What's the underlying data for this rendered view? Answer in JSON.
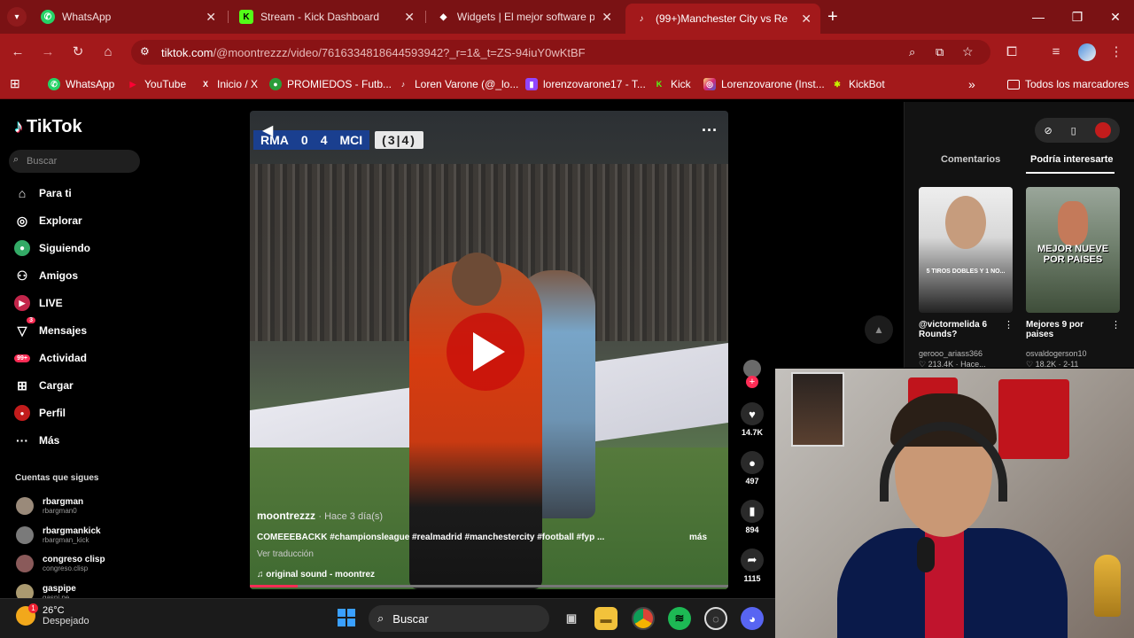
{
  "browser": {
    "tabs": [
      {
        "title": "WhatsApp",
        "icon": "whatsapp-icon",
        "color": "#25d366"
      },
      {
        "title": "Stream - Kick Dashboard",
        "icon": "kick-icon",
        "color": "#53fc18"
      },
      {
        "title": "Widgets | El mejor software par",
        "icon": "widgets-icon",
        "color": "#ffffff"
      },
      {
        "title": "(99+)Manchester City vs Re",
        "icon": "tiktok-icon",
        "color": "#ffffff"
      }
    ],
    "new_tab": "+",
    "url_main": "tiktok.com",
    "url_rest": "/@moontrezzz/video/7616334818644593942?_r=1&_t=ZS-94iuY0wKtBF",
    "bookmarks": [
      {
        "label": "WhatsApp",
        "icon": "whatsapp-icon"
      },
      {
        "label": "YouTube",
        "icon": "youtube-icon"
      },
      {
        "label": "Inicio / X",
        "icon": "x-icon"
      },
      {
        "label": "PROMIEDOS - Futb...",
        "icon": "promiedos-icon"
      },
      {
        "label": "Loren Varone (@_lo...",
        "icon": "tiktok-icon"
      },
      {
        "label": "lorenzovarone17 - T...",
        "icon": "twitch-icon"
      },
      {
        "label": "Kick",
        "icon": "kick-icon"
      },
      {
        "label": "Lorenzovarone (Inst...",
        "icon": "instagram-icon"
      },
      {
        "label": "KickBot",
        "icon": "kickbot-icon"
      }
    ],
    "all_bookmarks": "Todos los marcadores",
    "accent": "#a3191b"
  },
  "tiktok": {
    "logo": "TikTok",
    "search_placeholder": "Buscar",
    "nav": [
      {
        "label": "Para ti",
        "icon": "home-icon"
      },
      {
        "label": "Explorar",
        "icon": "compass-icon"
      },
      {
        "label": "Siguiendo",
        "icon": "following-icon"
      },
      {
        "label": "Amigos",
        "icon": "friends-icon"
      },
      {
        "label": "LIVE",
        "icon": "live-icon"
      },
      {
        "label": "Mensajes",
        "icon": "messages-icon",
        "badge": "3"
      },
      {
        "label": "Actividad",
        "icon": "activity-icon",
        "badge": "99+"
      },
      {
        "label": "Cargar",
        "icon": "upload-icon"
      },
      {
        "label": "Perfil",
        "icon": "profile-icon"
      },
      {
        "label": "Más",
        "icon": "more-icon"
      }
    ],
    "following_title": "Cuentas que sigues",
    "following": [
      {
        "name": "rbargman",
        "handle": "rbargman0"
      },
      {
        "name": "rbargmankick",
        "handle": "rbargman_kick"
      },
      {
        "name": "congreso clisp",
        "handle": "congreso.clisp"
      },
      {
        "name": "gaspipe",
        "handle": "gaspi.pe"
      }
    ],
    "video": {
      "score_home": "RMA",
      "score_home_goals": "0",
      "score_away_goals": "4",
      "score_away": "MCI",
      "aggregate": "(3|4)",
      "author": "moontrezzz",
      "posted": "· Hace 3 día(s)",
      "caption": "COMEEEBACKK #championsleague #realmadrid #manchestercity #football #fyp ...",
      "more": "más",
      "translate": "Ver traducción",
      "sound": "♫  original sound - moontrez",
      "progress_fraction": 0.1
    },
    "actions": {
      "likes": "14.7K",
      "comments": "497",
      "saves": "894",
      "shares": "1115"
    },
    "right_tabs": [
      "Comentarios",
      "Podría interesarte"
    ],
    "suggestions": [
      {
        "title": "@victormelida 6 Rounds?",
        "author": "gerooo_ariass366",
        "views": "♡ 213.4K · Hace...",
        "overlay": "5 TIROS DOBLES Y 1 NO..."
      },
      {
        "title": "Mejores 9 por paises",
        "author": "osvaldogerson10",
        "views": "♡ 18.2K · 2-11",
        "overlay": "MEJOR NUEVE POR PAISES"
      }
    ]
  },
  "taskbar": {
    "temp": "26°C",
    "condition": "Despejado",
    "search": "Buscar",
    "weather_badge": "1"
  }
}
